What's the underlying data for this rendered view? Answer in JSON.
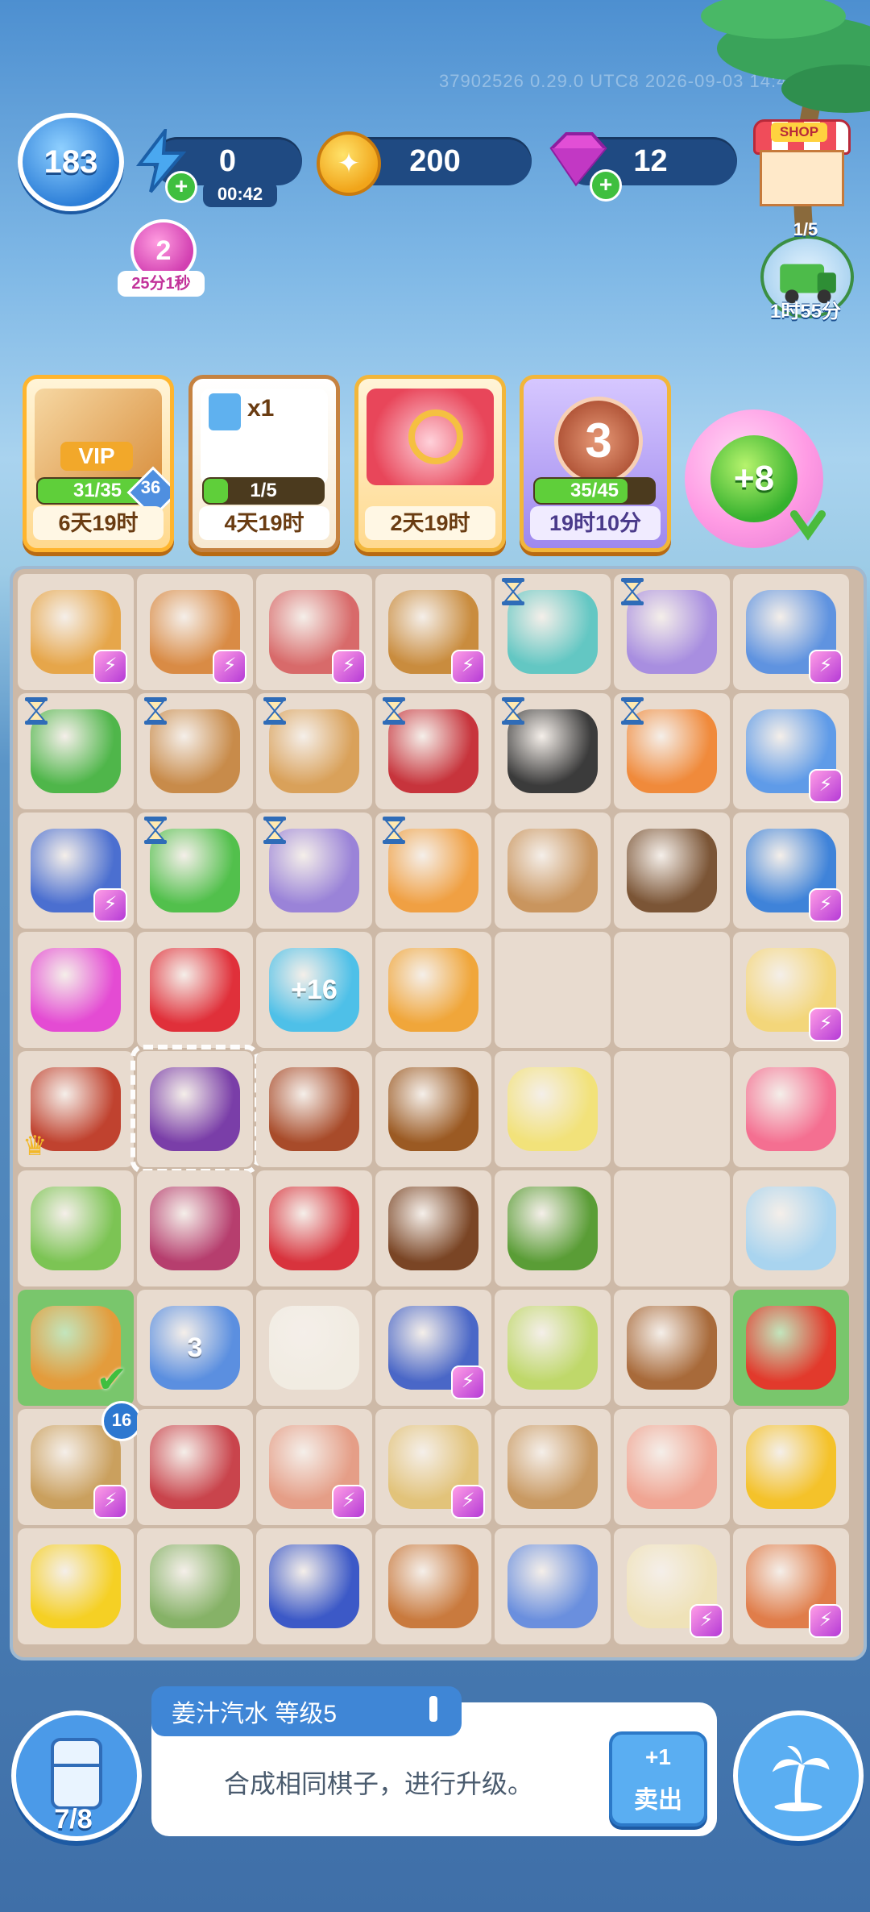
{
  "watermark": "37902526 0.29.0 UTC8 2026-09-03 14:48",
  "hud": {
    "player_level": "183",
    "energy": "0",
    "energy_timer": "00:42",
    "coins": "200",
    "gems": "12",
    "shop_label": "SHOP",
    "boost_value": "2",
    "boost_timer": "25分1秒",
    "delivery_count": "1/5",
    "delivery_timer": "1时55分"
  },
  "events": [
    {
      "label": "VIP",
      "progress_text": "31/35",
      "badge": "36",
      "progress": 0.886,
      "time": "6天19时"
    },
    {
      "label": "x1",
      "progress_text": "1/5",
      "progress": 0.2,
      "time": "4天19时"
    },
    {
      "label": "",
      "progress_text": "",
      "progress": 0,
      "time": "2天19时"
    },
    {
      "label": "3",
      "progress_text": "35/45",
      "progress": 0.778,
      "time": "19时10分"
    }
  ],
  "bubble_reward": "+8",
  "board": {
    "rows": [
      [
        {
          "name": "fruit-basket",
          "color": "#e6a64a",
          "energy": true
        },
        {
          "name": "veggie-basket",
          "color": "#d98b45",
          "energy": true
        },
        {
          "name": "meat-counter",
          "color": "#d86a6a",
          "energy": true
        },
        {
          "name": "picnic-basket",
          "color": "#c98c3e",
          "energy": true
        },
        {
          "name": "blender",
          "color": "#63c7c3",
          "hourglass": true
        },
        {
          "name": "oven",
          "color": "#a88ee0",
          "hourglass": true
        },
        {
          "name": "fridge",
          "color": "#5f93e0",
          "energy": true
        }
      ],
      [
        {
          "name": "grill",
          "color": "#4fb64a",
          "hourglass": true
        },
        {
          "name": "cutting-station",
          "color": "#c88b4a",
          "hourglass": true
        },
        {
          "name": "knife-board",
          "color": "#d9a15a",
          "hourglass": true
        },
        {
          "name": "frying-pan-red",
          "color": "#c7343c",
          "hourglass": true
        },
        {
          "name": "frying-pan",
          "color": "#3b3b3b",
          "hourglass": true
        },
        {
          "name": "casserole",
          "color": "#f08a3b",
          "hourglass": true
        },
        {
          "name": "arch-oven",
          "color": "#5f9be8",
          "energy": true
        }
      ],
      [
        {
          "name": "pot",
          "color": "#4b6fd0",
          "energy": true
        },
        {
          "name": "green-grill",
          "color": "#52c04c",
          "hourglass": true
        },
        {
          "name": "steamer",
          "color": "#9a83d8",
          "hourglass": true
        },
        {
          "name": "pumpkin-pot",
          "color": "#f0a043",
          "hourglass": true
        },
        {
          "name": "coffee-cup",
          "color": "#c9955e"
        },
        {
          "name": "coffee-machine",
          "color": "#7b5536"
        },
        {
          "name": "tile",
          "color": "#3f83d9",
          "energy": true
        }
      ],
      [
        {
          "name": "gems",
          "color": "#e44bd3"
        },
        {
          "name": "apple",
          "color": "#e0303a"
        },
        {
          "name": "energy-bubble",
          "color": "#4ec0e8",
          "text": "+16"
        },
        {
          "name": "tonic-water-can",
          "color": "#f0a63a"
        },
        {
          "name": "empty"
        },
        {
          "name": "empty"
        },
        {
          "name": "storage-box",
          "color": "#f3d67a",
          "energy": true
        }
      ],
      [
        {
          "name": "sausage-board",
          "color": "#c0422f",
          "crown": true
        },
        {
          "name": "ginger-ale-can",
          "color": "#7a3ea8",
          "selected": true
        },
        {
          "name": "lafite-bottle",
          "color": "#a84b2a"
        },
        {
          "name": "whiskey-bottle",
          "color": "#9b5a23"
        },
        {
          "name": "muller-bottle",
          "color": "#f2e27a"
        },
        {
          "name": "empty"
        },
        {
          "name": "octopus",
          "color": "#f46f91"
        }
      ],
      [
        {
          "name": "scallions",
          "color": "#7cc454"
        },
        {
          "name": "onion",
          "color": "#b63e6e"
        },
        {
          "name": "red-cake",
          "color": "#d8333d"
        },
        {
          "name": "coffee-beans",
          "color": "#7a4525"
        },
        {
          "name": "tea-leaves",
          "color": "#5a9d36"
        },
        {
          "name": "empty"
        },
        {
          "name": "glass-bowl",
          "color": "#a9d4ef"
        }
      ],
      [
        {
          "name": "bacardi-bottle",
          "color": "#e39c3c",
          "green": true,
          "check": true
        },
        {
          "name": "milk-carton",
          "color": "#5b8fe0",
          "text": "3"
        },
        {
          "name": "sugar-cubes",
          "color": "#f1ece2"
        },
        {
          "name": "bead-net",
          "color": "#4a67c7",
          "energy": true
        },
        {
          "name": "tea-bag",
          "color": "#bfd86a"
        },
        {
          "name": "tea-cup",
          "color": "#a86a3a"
        },
        {
          "name": "tomato",
          "color": "#e23a2c",
          "green": true
        }
      ],
      [
        {
          "name": "totem",
          "color": "#caa05e",
          "energy": true,
          "badge": "16"
        },
        {
          "name": "steak",
          "color": "#c9444c"
        },
        {
          "name": "chicken-box",
          "color": "#e59e87",
          "energy": true
        },
        {
          "name": "vanilla-plate",
          "color": "#e2c37a",
          "energy": true
        },
        {
          "name": "potatoes",
          "color": "#c99a63"
        },
        {
          "name": "salmon",
          "color": "#f0a593"
        },
        {
          "name": "corn-kernels",
          "color": "#f4c22a"
        }
      ],
      [
        {
          "name": "lemon",
          "color": "#f5d024"
        },
        {
          "name": "fish",
          "color": "#86b267"
        },
        {
          "name": "blueberries",
          "color": "#3c59c7"
        },
        {
          "name": "tea-glass",
          "color": "#c97a3e"
        },
        {
          "name": "blue-fish",
          "color": "#6a8fde"
        },
        {
          "name": "sugar-jar",
          "color": "#efe2b8",
          "energy": true
        },
        {
          "name": "salad-box",
          "color": "#e07d4a",
          "energy": true
        }
      ]
    ]
  },
  "info": {
    "title": "姜汁汽水   等级5",
    "description": "合成相同棋子，进行升级。",
    "sell_value": "+1",
    "sell_label": "卖出"
  },
  "fridge_count": "7/8"
}
